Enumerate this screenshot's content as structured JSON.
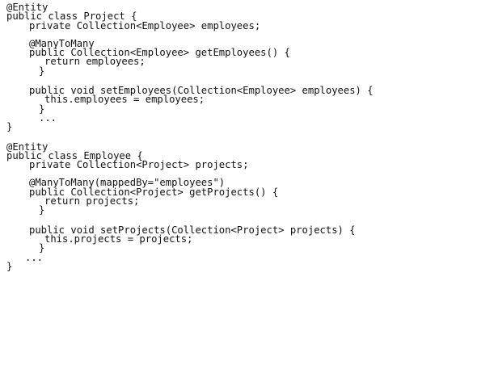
{
  "snippet1": {
    "annotation": "@Entity",
    "class_decl": "public class Project {",
    "field": "private Collection<Employee> employees;",
    "getter_annotation": "@ManyToMany",
    "getter_sig": "public Collection<Employee> getEmployees() {",
    "getter_body": "return employees;",
    "getter_close": "}",
    "setter_sig": "public void setEmployees(Collection<Employee> employees) {",
    "setter_body": "this.employees = employees;",
    "setter_close": "}",
    "ellipsis": "...",
    "class_close": "}"
  },
  "snippet2": {
    "annotation": "@Entity",
    "class_decl": "public class Employee {",
    "field": "private Collection<Project> projects;",
    "getter_annotation": "@ManyToMany(mappedBy=\"employees\")",
    "getter_sig": "public Collection<Project> getProjects() {",
    "getter_body": "return projects;",
    "getter_close": "}",
    "setter_sig": "public void setProjects(Collection<Project> projects) {",
    "setter_body": "this.projects = projects;",
    "setter_close": "}",
    "ellipsis": "...",
    "class_close": "}"
  }
}
